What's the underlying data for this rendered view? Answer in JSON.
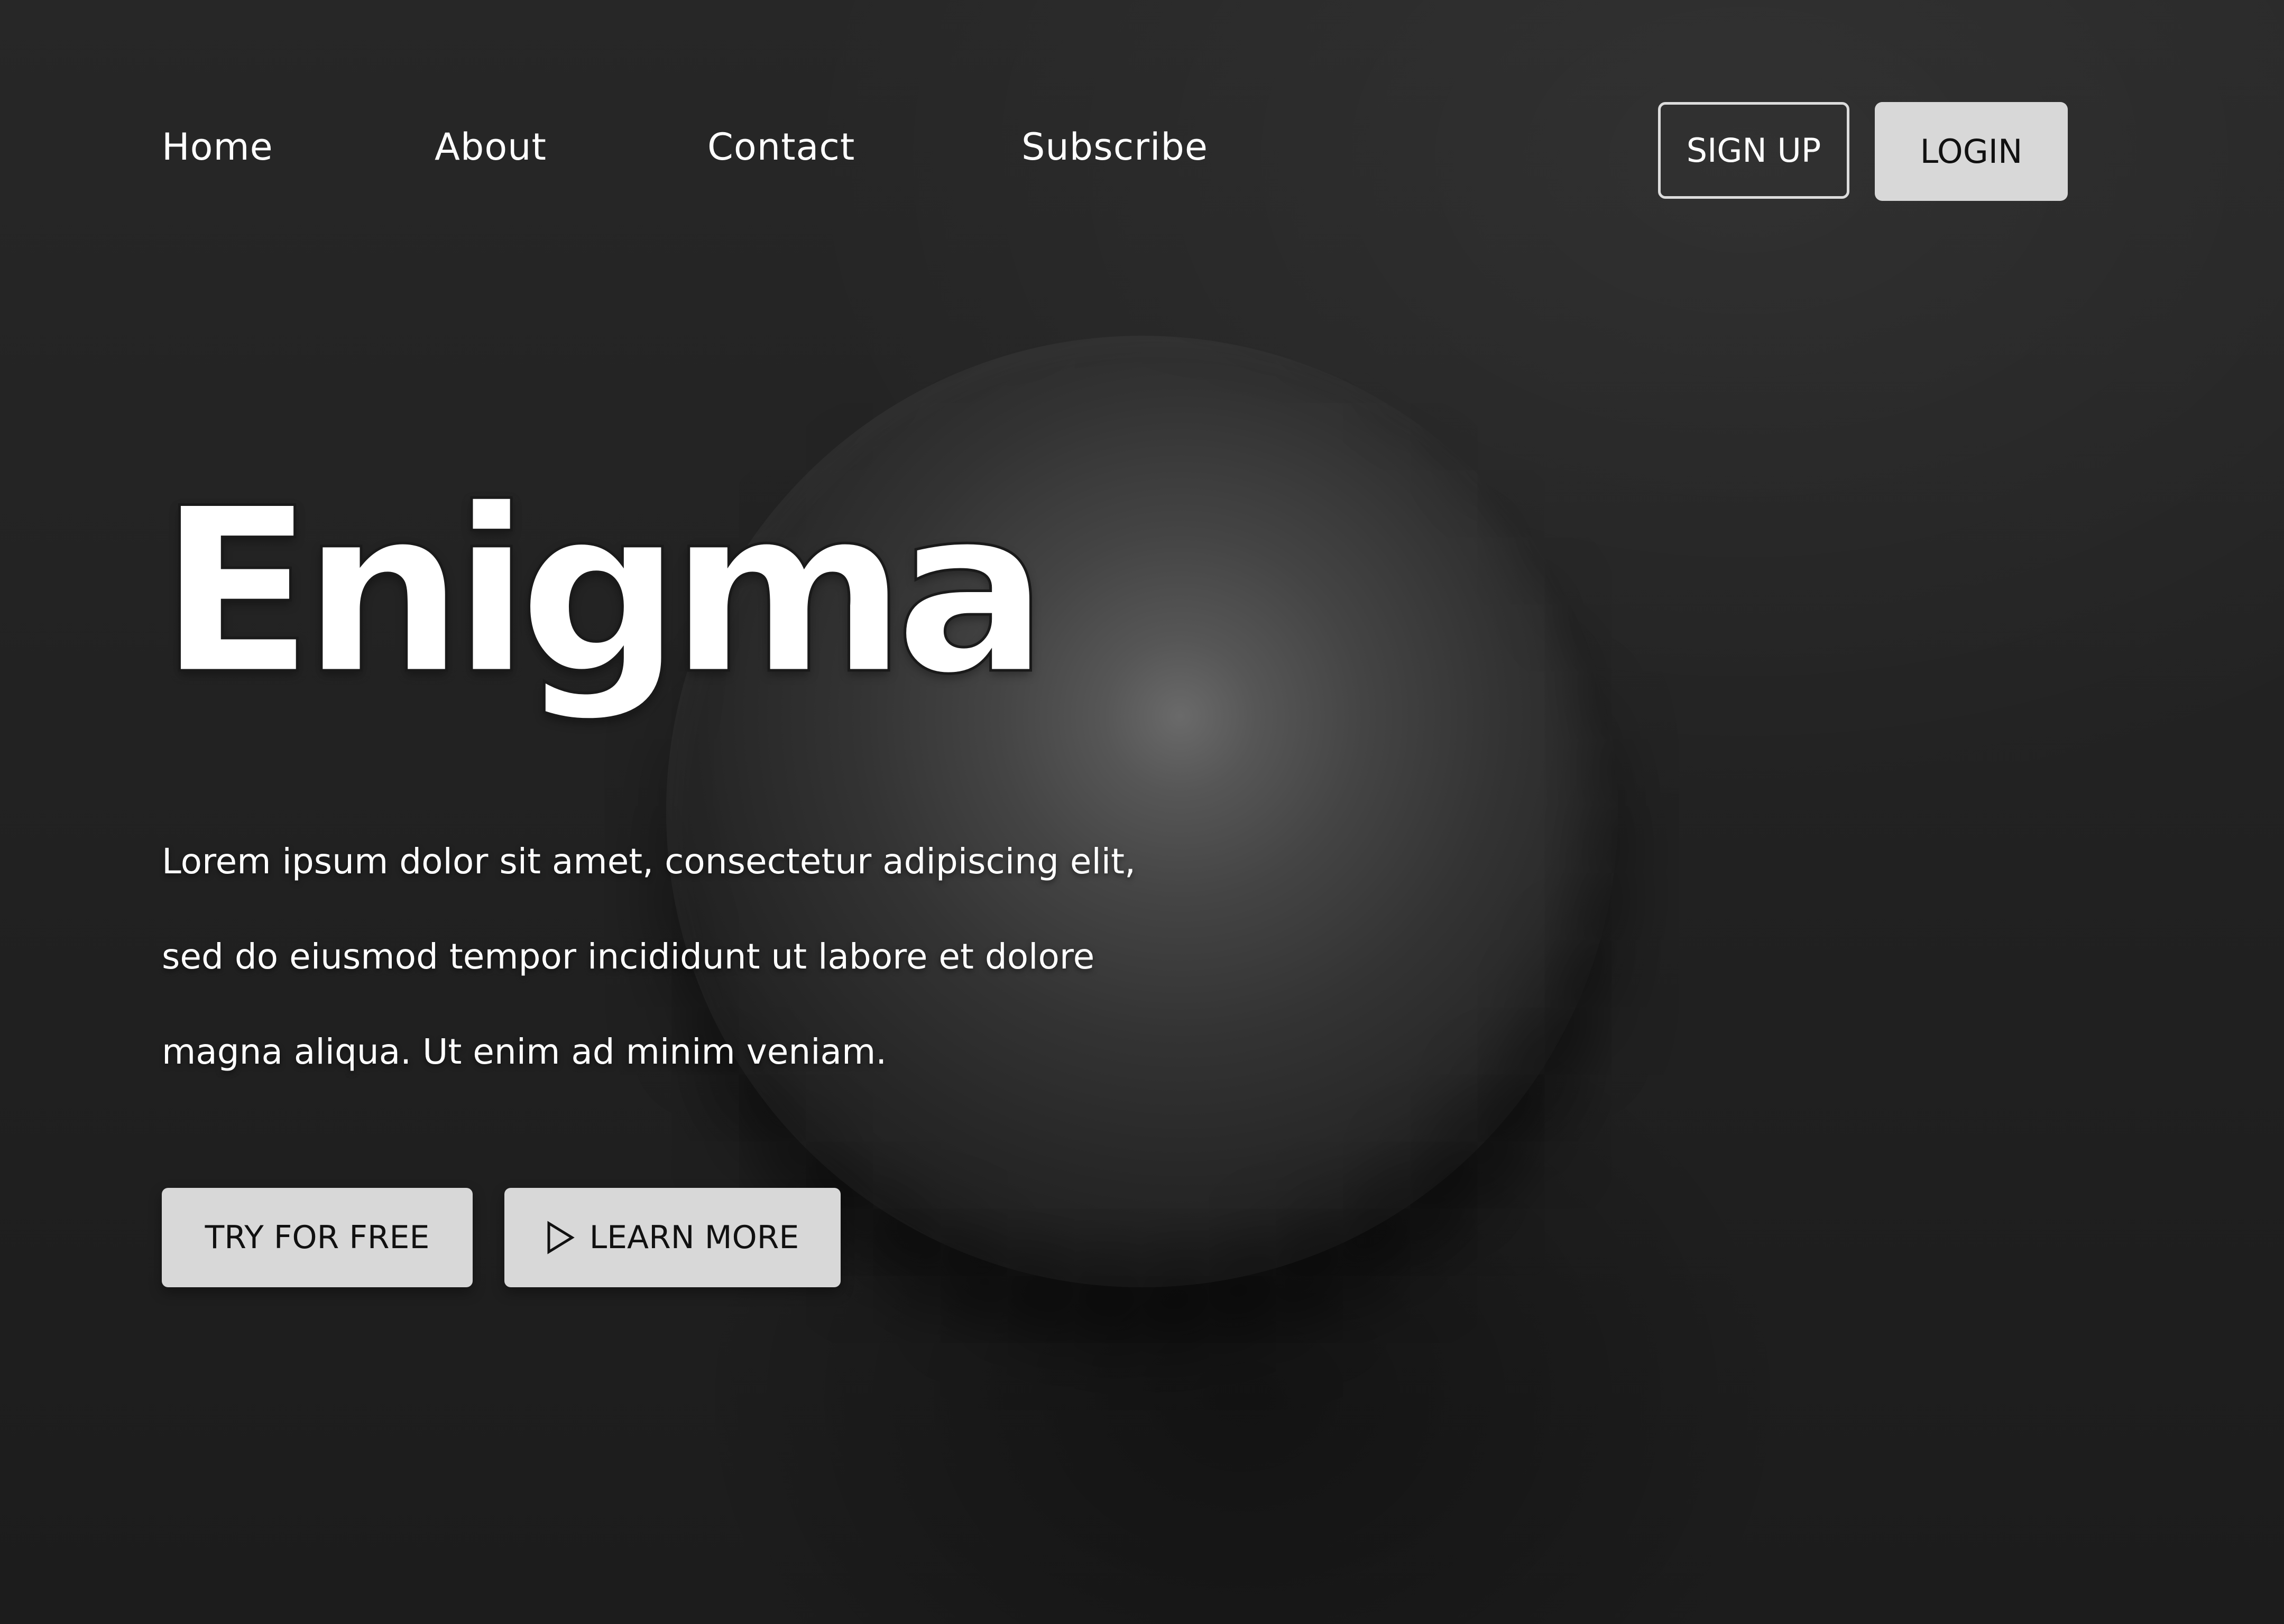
{
  "nav": {
    "items": [
      {
        "label": "Home"
      },
      {
        "label": "About"
      },
      {
        "label": "Contact"
      },
      {
        "label": "Subscribe"
      }
    ],
    "signup_label": "SIGN UP",
    "login_label": "LOGIN"
  },
  "hero": {
    "title": "Enigma",
    "lines": [
      "Lorem ipsum dolor sit amet, consectetur adipiscing elit,",
      "sed do eiusmod tempor incididunt ut labore et dolore",
      "magna aliqua. Ut enim ad minim veniam."
    ],
    "primary_cta": "TRY FOR FREE",
    "secondary_cta": "LEARN MORE",
    "secondary_cta_icon": "play-icon"
  },
  "colors": {
    "background": "#222222",
    "button_fill": "#d8d8d8",
    "text": "#ffffff"
  }
}
